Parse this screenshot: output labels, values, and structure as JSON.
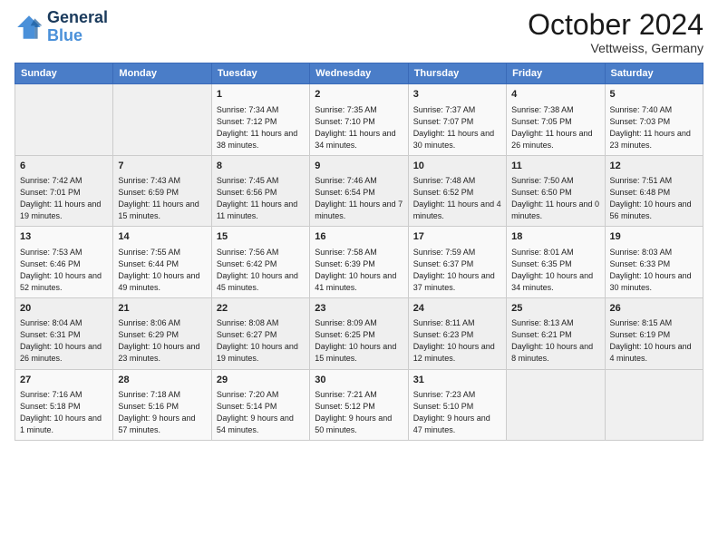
{
  "header": {
    "logo_line1": "General",
    "logo_line2": "Blue",
    "month": "October 2024",
    "location": "Vettweiss, Germany"
  },
  "weekdays": [
    "Sunday",
    "Monday",
    "Tuesday",
    "Wednesday",
    "Thursday",
    "Friday",
    "Saturday"
  ],
  "weeks": [
    [
      {
        "day": "",
        "info": ""
      },
      {
        "day": "",
        "info": ""
      },
      {
        "day": "1",
        "info": "Sunrise: 7:34 AM\nSunset: 7:12 PM\nDaylight: 11 hours and 38 minutes."
      },
      {
        "day": "2",
        "info": "Sunrise: 7:35 AM\nSunset: 7:10 PM\nDaylight: 11 hours and 34 minutes."
      },
      {
        "day": "3",
        "info": "Sunrise: 7:37 AM\nSunset: 7:07 PM\nDaylight: 11 hours and 30 minutes."
      },
      {
        "day": "4",
        "info": "Sunrise: 7:38 AM\nSunset: 7:05 PM\nDaylight: 11 hours and 26 minutes."
      },
      {
        "day": "5",
        "info": "Sunrise: 7:40 AM\nSunset: 7:03 PM\nDaylight: 11 hours and 23 minutes."
      }
    ],
    [
      {
        "day": "6",
        "info": "Sunrise: 7:42 AM\nSunset: 7:01 PM\nDaylight: 11 hours and 19 minutes."
      },
      {
        "day": "7",
        "info": "Sunrise: 7:43 AM\nSunset: 6:59 PM\nDaylight: 11 hours and 15 minutes."
      },
      {
        "day": "8",
        "info": "Sunrise: 7:45 AM\nSunset: 6:56 PM\nDaylight: 11 hours and 11 minutes."
      },
      {
        "day": "9",
        "info": "Sunrise: 7:46 AM\nSunset: 6:54 PM\nDaylight: 11 hours and 7 minutes."
      },
      {
        "day": "10",
        "info": "Sunrise: 7:48 AM\nSunset: 6:52 PM\nDaylight: 11 hours and 4 minutes."
      },
      {
        "day": "11",
        "info": "Sunrise: 7:50 AM\nSunset: 6:50 PM\nDaylight: 11 hours and 0 minutes."
      },
      {
        "day": "12",
        "info": "Sunrise: 7:51 AM\nSunset: 6:48 PM\nDaylight: 10 hours and 56 minutes."
      }
    ],
    [
      {
        "day": "13",
        "info": "Sunrise: 7:53 AM\nSunset: 6:46 PM\nDaylight: 10 hours and 52 minutes."
      },
      {
        "day": "14",
        "info": "Sunrise: 7:55 AM\nSunset: 6:44 PM\nDaylight: 10 hours and 49 minutes."
      },
      {
        "day": "15",
        "info": "Sunrise: 7:56 AM\nSunset: 6:42 PM\nDaylight: 10 hours and 45 minutes."
      },
      {
        "day": "16",
        "info": "Sunrise: 7:58 AM\nSunset: 6:39 PM\nDaylight: 10 hours and 41 minutes."
      },
      {
        "day": "17",
        "info": "Sunrise: 7:59 AM\nSunset: 6:37 PM\nDaylight: 10 hours and 37 minutes."
      },
      {
        "day": "18",
        "info": "Sunrise: 8:01 AM\nSunset: 6:35 PM\nDaylight: 10 hours and 34 minutes."
      },
      {
        "day": "19",
        "info": "Sunrise: 8:03 AM\nSunset: 6:33 PM\nDaylight: 10 hours and 30 minutes."
      }
    ],
    [
      {
        "day": "20",
        "info": "Sunrise: 8:04 AM\nSunset: 6:31 PM\nDaylight: 10 hours and 26 minutes."
      },
      {
        "day": "21",
        "info": "Sunrise: 8:06 AM\nSunset: 6:29 PM\nDaylight: 10 hours and 23 minutes."
      },
      {
        "day": "22",
        "info": "Sunrise: 8:08 AM\nSunset: 6:27 PM\nDaylight: 10 hours and 19 minutes."
      },
      {
        "day": "23",
        "info": "Sunrise: 8:09 AM\nSunset: 6:25 PM\nDaylight: 10 hours and 15 minutes."
      },
      {
        "day": "24",
        "info": "Sunrise: 8:11 AM\nSunset: 6:23 PM\nDaylight: 10 hours and 12 minutes."
      },
      {
        "day": "25",
        "info": "Sunrise: 8:13 AM\nSunset: 6:21 PM\nDaylight: 10 hours and 8 minutes."
      },
      {
        "day": "26",
        "info": "Sunrise: 8:15 AM\nSunset: 6:19 PM\nDaylight: 10 hours and 4 minutes."
      }
    ],
    [
      {
        "day": "27",
        "info": "Sunrise: 7:16 AM\nSunset: 5:18 PM\nDaylight: 10 hours and 1 minute."
      },
      {
        "day": "28",
        "info": "Sunrise: 7:18 AM\nSunset: 5:16 PM\nDaylight: 9 hours and 57 minutes."
      },
      {
        "day": "29",
        "info": "Sunrise: 7:20 AM\nSunset: 5:14 PM\nDaylight: 9 hours and 54 minutes."
      },
      {
        "day": "30",
        "info": "Sunrise: 7:21 AM\nSunset: 5:12 PM\nDaylight: 9 hours and 50 minutes."
      },
      {
        "day": "31",
        "info": "Sunrise: 7:23 AM\nSunset: 5:10 PM\nDaylight: 9 hours and 47 minutes."
      },
      {
        "day": "",
        "info": ""
      },
      {
        "day": "",
        "info": ""
      }
    ]
  ]
}
